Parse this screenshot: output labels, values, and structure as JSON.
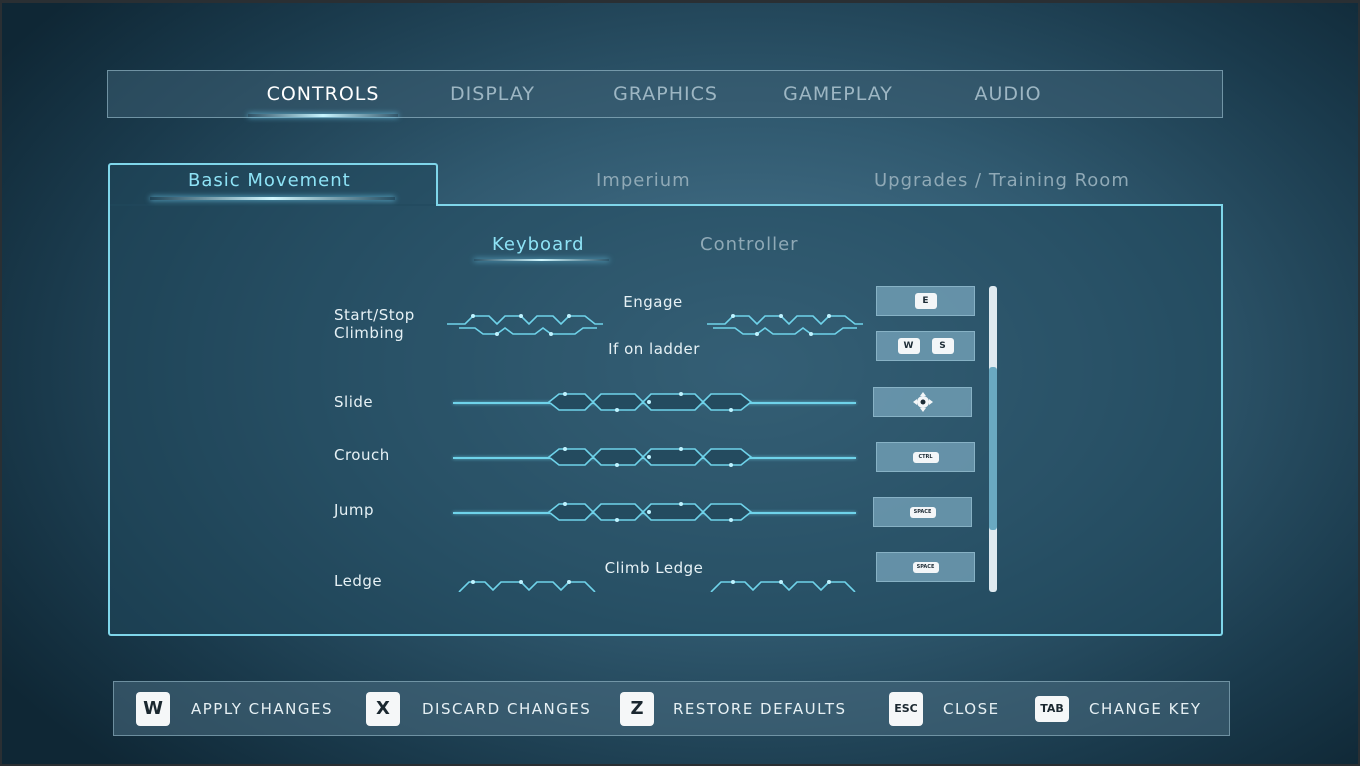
{
  "nav": {
    "tabs": [
      "CONTROLS",
      "DISPLAY",
      "GRAPHICS",
      "GAMEPLAY",
      "AUDIO"
    ],
    "active": "CONTROLS"
  },
  "categories": {
    "tabs": [
      "Basic Movement",
      "Imperium",
      "Upgrades / Training Room"
    ],
    "active": "Basic Movement"
  },
  "devices": {
    "tabs": [
      "Keyboard",
      "Controller"
    ],
    "active": "Keyboard"
  },
  "bindings": {
    "start_stop": {
      "label": "Start/Stop\nClimbing",
      "engage_label": "Engage",
      "ladder_label": "If on ladder",
      "engage_keys": [
        "E"
      ],
      "ladder_keys": [
        "W",
        "S"
      ]
    },
    "slide": {
      "label": "Slide",
      "key_icon": "dpad-icon"
    },
    "crouch": {
      "label": "Crouch",
      "key": "CTRL"
    },
    "jump": {
      "label": "Jump",
      "key": "SPACE"
    },
    "ledge": {
      "label": "Ledge",
      "action_label": "Climb Ledge",
      "key": "SPACE"
    }
  },
  "scrollbar": {
    "position": 0.35,
    "visible_fraction": 0.53
  },
  "hints": [
    {
      "key": "W",
      "label": "APPLY CHANGES"
    },
    {
      "key": "X",
      "label": "DISCARD CHANGES"
    },
    {
      "key": "Z",
      "label": "RESTORE DEFAULTS"
    },
    {
      "key": "ESC",
      "label": "CLOSE"
    },
    {
      "key": "TAB",
      "label": "CHANGE KEY"
    }
  ],
  "colors": {
    "accent": "#7fd6ea",
    "active_text": "#8ee3f6",
    "inactive_text": "#9db6c3"
  }
}
